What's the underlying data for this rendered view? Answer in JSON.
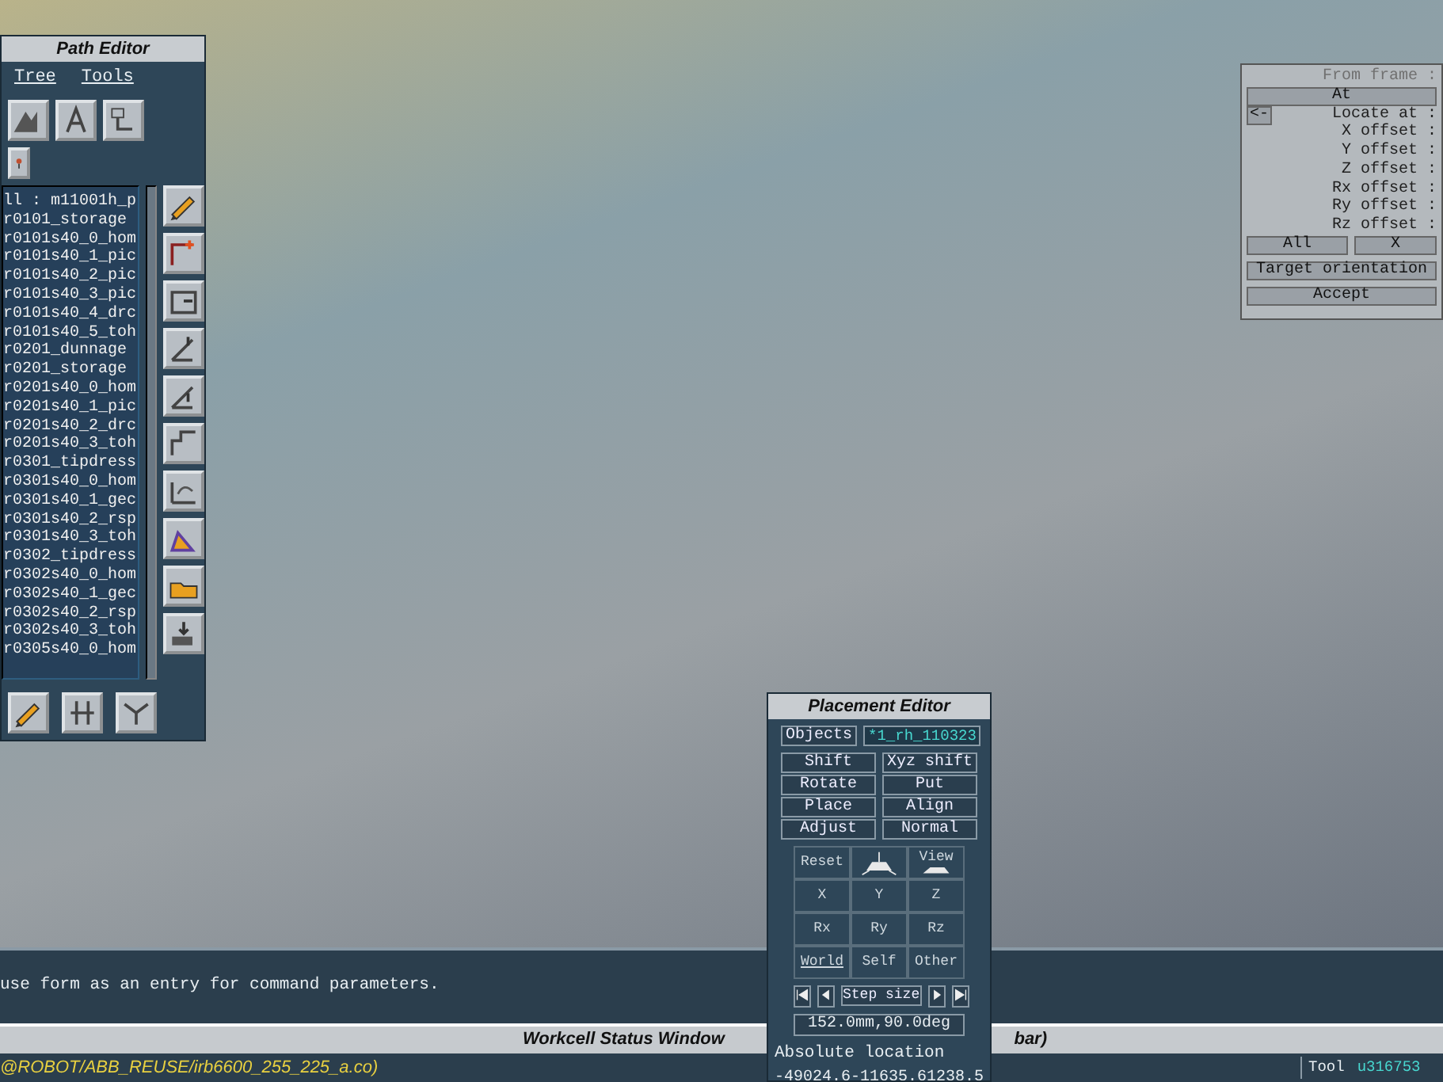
{
  "path_editor": {
    "title": "Path Editor",
    "menu": [
      "Tree",
      "Tools"
    ],
    "items": [
      "ll : m11001h_p",
      "r0101_storage",
      "r0101s40_0_hom",
      "r0101s40_1_pic",
      "r0101s40_2_pic",
      "r0101s40_3_pic",
      "r0101s40_4_drc",
      "r0101s40_5_toh",
      "r0201_dunnage",
      "r0201_storage",
      "r0201s40_0_hom",
      "r0201s40_1_pic",
      "r0201s40_2_drc",
      "r0201s40_3_toh",
      "r0301_tipdress",
      "r0301s40_0_hom",
      "r0301s40_1_gec",
      "r0301s40_2_rsp",
      "r0301s40_3_toh",
      "r0302_tipdress",
      "r0302s40_0_hom",
      "r0302s40_1_gec",
      "r0302s40_2_rsp",
      "r0302s40_3_toh",
      "r0305s40_0_hom"
    ]
  },
  "frame_panel": {
    "from_frame": "From frame :",
    "at": "At",
    "back": "<-",
    "fields": [
      "Locate at :",
      "X offset :",
      "Y offset :",
      "Z offset :",
      "Rx offset :",
      "Ry offset :",
      "Rz offset :"
    ],
    "all": "All",
    "x": "X",
    "target_orientation": "Target orientation",
    "accept": "Accept"
  },
  "placement_editor": {
    "title": "Placement Editor",
    "objects": "Objects",
    "object_value": "*1_rh_110323",
    "modes": [
      "Shift",
      "Xyz shift",
      "Rotate",
      "Put",
      "Place",
      "Align",
      "Adjust",
      "Normal"
    ],
    "grid": [
      {
        "kind": "text",
        "label": "Reset"
      },
      {
        "kind": "axes"
      },
      {
        "kind": "view",
        "label": "View"
      },
      {
        "kind": "text",
        "label": "X"
      },
      {
        "kind": "text",
        "label": "Y"
      },
      {
        "kind": "text",
        "label": "Z"
      },
      {
        "kind": "text",
        "label": "Rx"
      },
      {
        "kind": "text",
        "label": "Ry"
      },
      {
        "kind": "text",
        "label": "Rz"
      },
      {
        "kind": "underlined",
        "label": "World"
      },
      {
        "kind": "text",
        "label": "Self"
      },
      {
        "kind": "text",
        "label": "Other"
      }
    ],
    "step_label": "Step size",
    "step_value": "152.0mm,90.0deg",
    "location_label": "Absolute location",
    "location_value": "-49024.6-11635.61238.5"
  },
  "message": "use form as an entry for command parameters.",
  "status_window": {
    "title": "Workcell Status Window",
    "title_tail": "bar)",
    "path": "@ROBOT/ABB_REUSE/irb6600_255_225_a.co)",
    "tool_label": "Tool",
    "tool_value": "u316753"
  }
}
